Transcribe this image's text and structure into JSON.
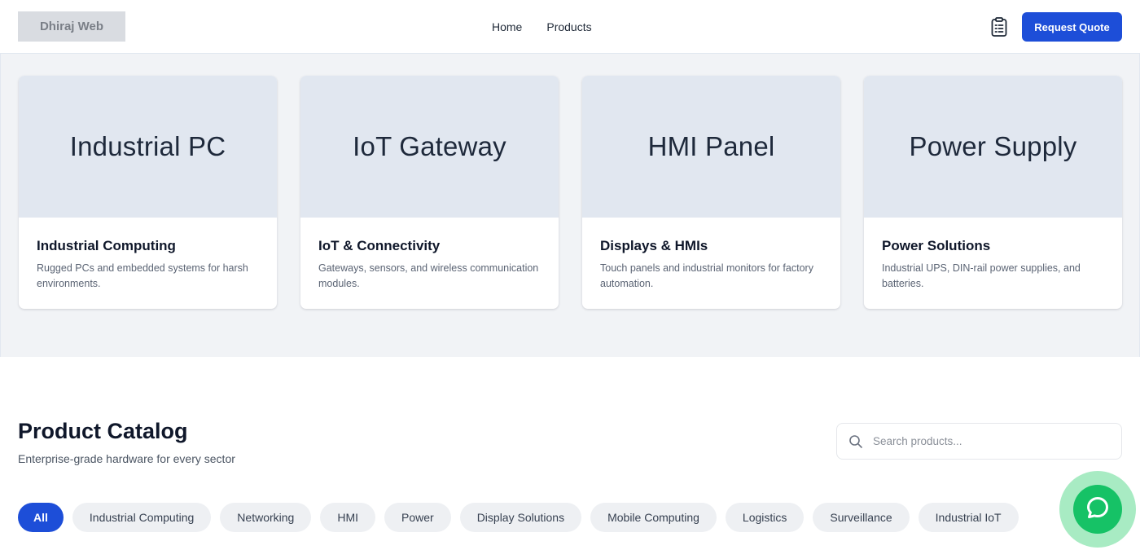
{
  "header": {
    "logo": "Dhiraj Web",
    "nav": [
      "Home",
      "Products"
    ],
    "quote_button": "Request Quote",
    "accent_color": "#1d4ed8"
  },
  "categories": [
    {
      "image_label": "Industrial PC",
      "title": "Industrial Computing",
      "description": "Rugged PCs and embedded systems for harsh environments."
    },
    {
      "image_label": "IoT Gateway",
      "title": "IoT & Connectivity",
      "description": "Gateways, sensors, and wireless communication modules."
    },
    {
      "image_label": "HMI Panel",
      "title": "Displays & HMIs",
      "description": "Touch panels and industrial monitors for factory automation."
    },
    {
      "image_label": "Power Supply",
      "title": "Power Solutions",
      "description": "Industrial UPS, DIN-rail power supplies, and batteries."
    }
  ],
  "catalog": {
    "title": "Product Catalog",
    "subtitle": "Enterprise-grade hardware for every sector",
    "search_placeholder": "Search products...",
    "filters": [
      "All",
      "Industrial Computing",
      "Networking",
      "HMI",
      "Power",
      "Display Solutions",
      "Mobile Computing",
      "Logistics",
      "Surveillance",
      "Industrial IoT"
    ],
    "active_filter": "All"
  },
  "icons": {
    "quote_list": "clipboard-list-icon",
    "search": "search-icon",
    "chat": "chat-bubble-icon",
    "chat_color": "#16c266"
  }
}
